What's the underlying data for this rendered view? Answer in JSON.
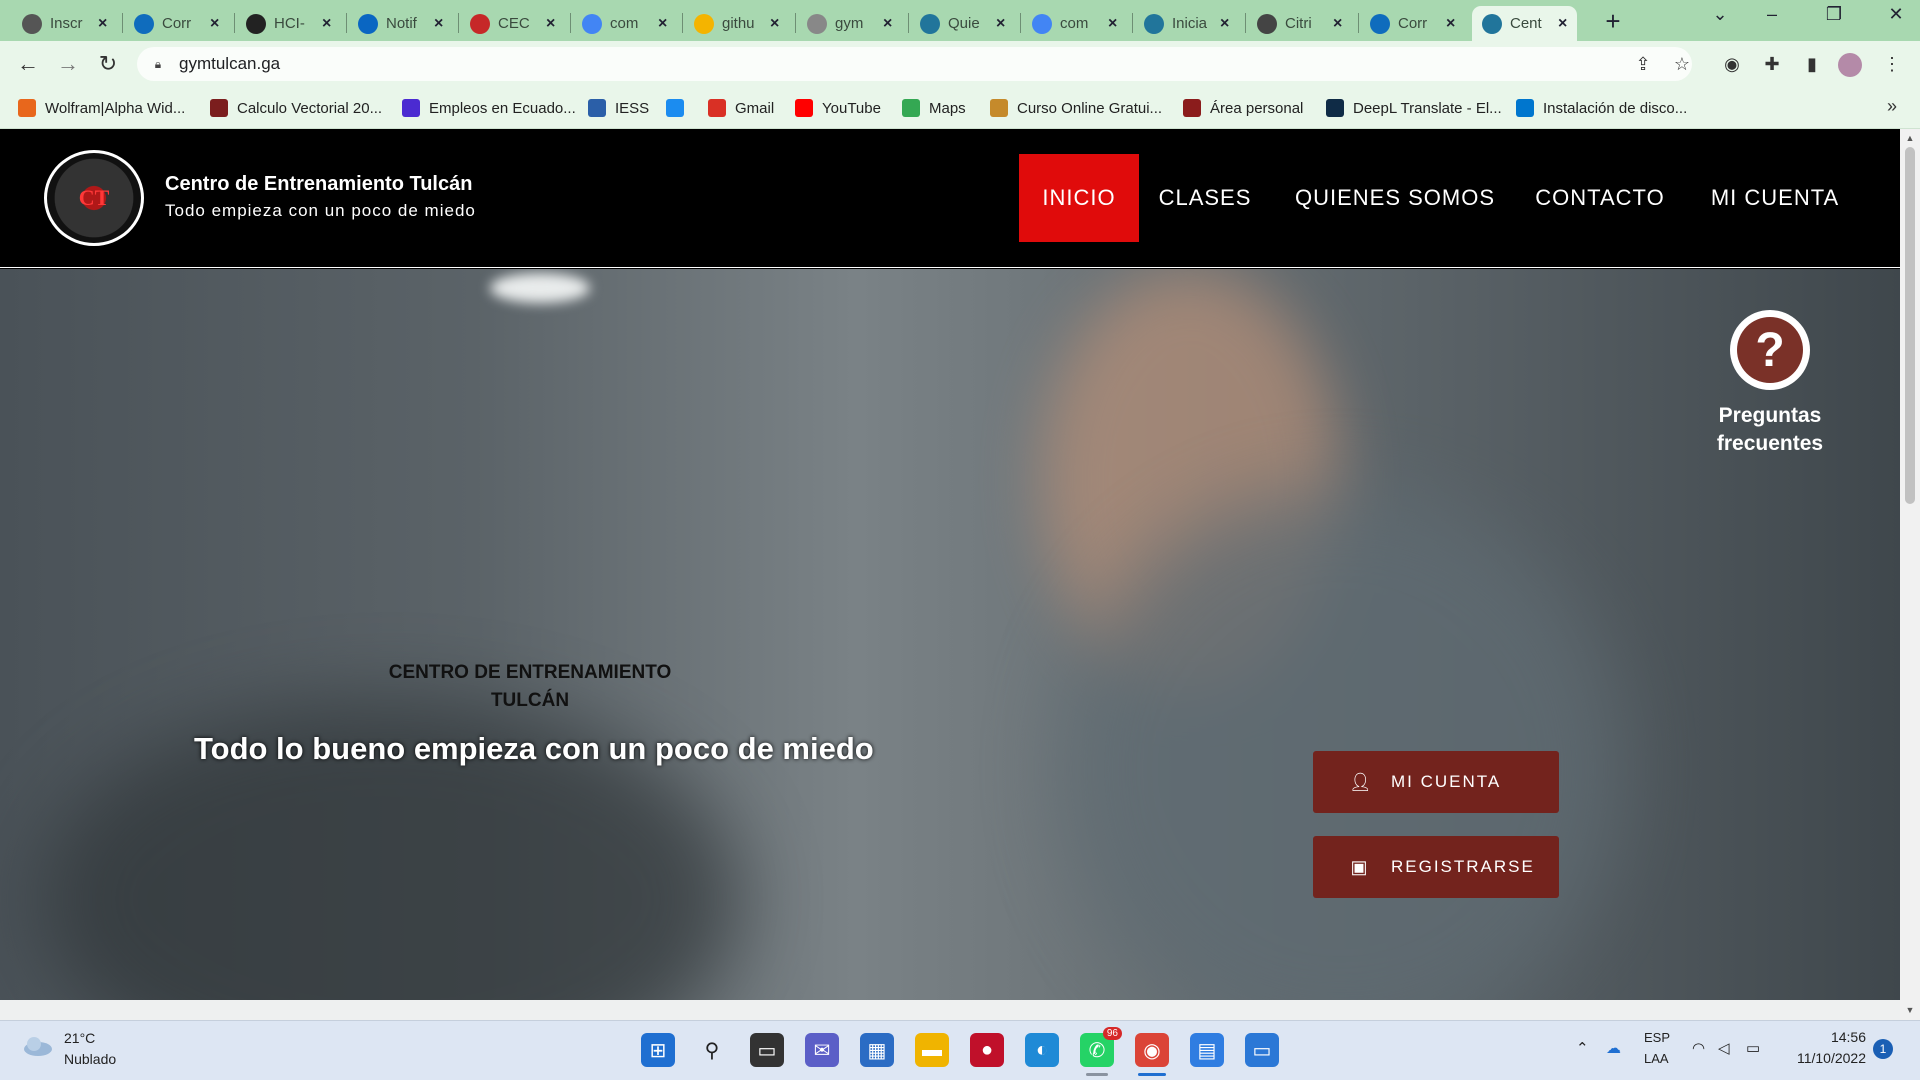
{
  "browser": {
    "tabs": [
      {
        "label": "Inscr",
        "favicon": "globe-icon",
        "color": "#555"
      },
      {
        "label": "Corr",
        "favicon": "outlook-icon",
        "color": "#0f6cbd"
      },
      {
        "label": "HCI-",
        "favicon": "github-icon",
        "color": "#222"
      },
      {
        "label": "Notif",
        "favicon": "linkedin-icon",
        "color": "#0a66c2"
      },
      {
        "label": "CEC",
        "favicon": "cec-icon",
        "color": "#c62828"
      },
      {
        "label": "com",
        "favicon": "google-icon",
        "color": "#4285f4"
      },
      {
        "label": "githu",
        "favicon": "drive-doc-icon",
        "color": "#f4b400"
      },
      {
        "label": "gym",
        "favicon": "loading-icon",
        "color": "#888"
      },
      {
        "label": "Quie",
        "favicon": "wordpress-icon",
        "color": "#21759b"
      },
      {
        "label": "com",
        "favicon": "google-icon",
        "color": "#4285f4"
      },
      {
        "label": "Inicia",
        "favicon": "wordpress-icon",
        "color": "#21759b"
      },
      {
        "label": "Citri",
        "favicon": "citrix-icon",
        "color": "#444"
      },
      {
        "label": "Corr",
        "favicon": "outlook-icon",
        "color": "#0f6cbd"
      },
      {
        "label": "Cent",
        "favicon": "wordpress-icon",
        "color": "#21759b"
      }
    ],
    "url": "gymtulcan.ga",
    "bookmarks": [
      {
        "label": "Wolfram|Alpha Wid...",
        "icon": "wolfram-icon",
        "color": "#e8671c"
      },
      {
        "label": "Calculo Vectorial 20...",
        "icon": "book-icon",
        "color": "#7b1e1e"
      },
      {
        "label": "Empleos en Ecuado...",
        "icon": "chevron-icon",
        "color": "#4b2bd1"
      },
      {
        "label": "IESS",
        "icon": "iess-icon",
        "color": "#2b5fa8"
      },
      {
        "label": "",
        "icon": "app-store-icon",
        "color": "#1b8cf0"
      },
      {
        "label": "Gmail",
        "icon": "gmail-icon",
        "color": "#d93025"
      },
      {
        "label": "YouTube",
        "icon": "youtube-icon",
        "color": "#ff0000"
      },
      {
        "label": "Maps",
        "icon": "maps-icon",
        "color": "#34a853"
      },
      {
        "label": "Curso Online Gratui...",
        "icon": "course-icon",
        "color": "#c58a2b"
      },
      {
        "label": "Área personal",
        "icon": "moodle-icon",
        "color": "#8b1c1c"
      },
      {
        "label": "DeepL Translate - El...",
        "icon": "deepl-icon",
        "color": "#0f2b46"
      },
      {
        "label": "Instalación de disco...",
        "icon": "dell-icon",
        "color": "#0076ce"
      }
    ]
  },
  "site": {
    "logo_text": "CT",
    "brand_title": "Centro de Entrenamiento Tulcán",
    "brand_tagline": "Todo empieza con un poco de miedo",
    "nav": [
      "INICIO",
      "CLASES",
      "QUIENES SOMOS",
      "CONTACTO",
      "MI CUENTA"
    ],
    "faq_label": "Preguntas frecuentes",
    "hero_kicker": "CENTRO DE ENTRENAMIENTO TULCÁN",
    "hero_title": "Todo lo bueno empieza con un poco de miedo",
    "cta_account": "MI CUENTA",
    "cta_register": "REGISTRARSE",
    "accent": "#e00b0b",
    "button_color": "#73231d"
  },
  "taskbar": {
    "temperature": "21°C",
    "condition": "Nublado",
    "lang_top": "ESP",
    "lang_bottom": "LAA",
    "time": "14:56",
    "date": "11/10/2022",
    "notifications": "1",
    "whatsapp_badge": "96"
  }
}
